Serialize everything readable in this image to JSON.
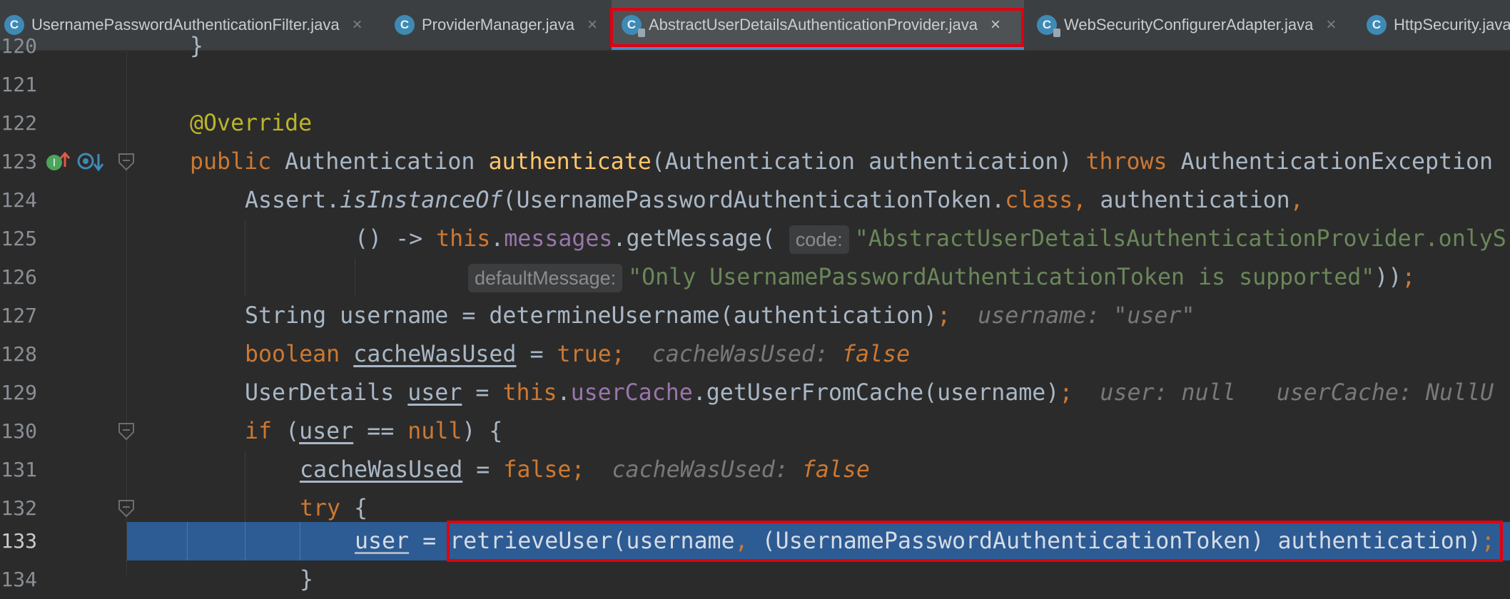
{
  "tabs": [
    {
      "label": "UsernamePasswordAuthenticationFilter.java",
      "active": false
    },
    {
      "label": "ProviderManager.java",
      "active": false
    },
    {
      "label": "AbstractUserDetailsAuthenticationProvider.java",
      "active": true
    },
    {
      "label": "WebSecurityConfigurerAdapter.java",
      "active": false
    },
    {
      "label": "HttpSecurity.java",
      "active": false
    }
  ],
  "icons": {
    "tab_file": "java-class-icon",
    "close": "close-icon",
    "fold": "fold-icon",
    "implements": "implements-icon",
    "override": "override-icon"
  },
  "colors": {
    "keyword": "#cc7832",
    "annotation": "#bbb529",
    "method": "#ffc66d",
    "field": "#9876aa",
    "string": "#6a8759",
    "highlight": "#2d5b94",
    "outline": "#e00010"
  },
  "editor": {
    "lines": [
      {
        "num": "120",
        "text": "}"
      },
      {
        "num": "121",
        "text": ""
      },
      {
        "num": "122",
        "text": "@Override"
      },
      {
        "num": "123",
        "text": "public Authentication authenticate(Authentication authentication) throws AuthenticationException"
      },
      {
        "num": "124",
        "text": "Assert.isInstanceOf(UsernamePasswordAuthenticationToken.class, authentication,"
      },
      {
        "num": "125",
        "text": "() -> this.messages.getMessage( code: \"AbstractUserDetailsAuthenticationProvider.onlyS"
      },
      {
        "num": "126",
        "text": "defaultMessage: \"Only UsernamePasswordAuthenticationToken is supported\"));"
      },
      {
        "num": "127",
        "text": "String username = determineUsername(authentication);  username: \"user\""
      },
      {
        "num": "128",
        "text": "boolean cacheWasUsed = true;  cacheWasUsed: false"
      },
      {
        "num": "129",
        "text": "UserDetails user = this.userCache.getUserFromCache(username);  user: null   userCache: NullU"
      },
      {
        "num": "130",
        "text": "if (user == null) {"
      },
      {
        "num": "131",
        "text": "cacheWasUsed = false;  cacheWasUsed: false"
      },
      {
        "num": "132",
        "text": "try {"
      },
      {
        "num": "133",
        "text": "user = retrieveUser(username, (UsernamePasswordAuthenticationToken) authentication);"
      },
      {
        "num": "134",
        "text": "}"
      }
    ],
    "current_line": "133"
  }
}
